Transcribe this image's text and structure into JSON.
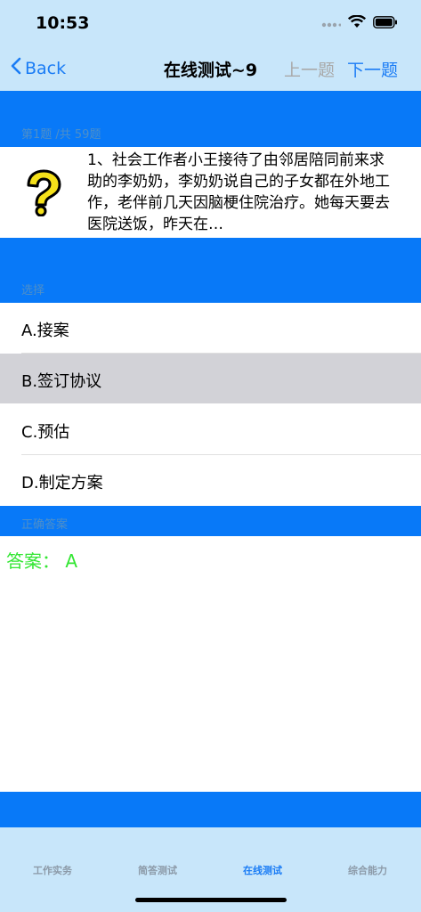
{
  "status_bar": {
    "time": "10:53"
  },
  "nav": {
    "back_label": "Back",
    "title": "在线测试~9",
    "prev_label": "上一题",
    "next_label": "下一题"
  },
  "question_section": {
    "label": "第1题 /共 59题",
    "text": "1、社会工作者小王接待了由邻居陪同前来求助的李奶奶，李奶奶说自己的子女都在外地工作，老伴前几天因脑梗住院治疗。她每天要去医院送饭，昨天在…"
  },
  "options_section": {
    "label": "选择",
    "options": [
      {
        "label": "A.接案"
      },
      {
        "label": "B.签订协议"
      },
      {
        "label": "C.预估"
      },
      {
        "label": "D.制定方案"
      }
    ]
  },
  "answer_section": {
    "label": "正确答案",
    "answer_text": "答案： A"
  },
  "tabs": [
    {
      "label": "工作实务"
    },
    {
      "label": "简答测试"
    },
    {
      "label": "在线测试"
    },
    {
      "label": "综合能力"
    }
  ],
  "colors": {
    "accent": "#1a7cf5",
    "band_blue": "#0879f8",
    "bar_background": "#c8e6fa",
    "answer_green": "#33e633",
    "selected_option": "#d2d2d7"
  }
}
